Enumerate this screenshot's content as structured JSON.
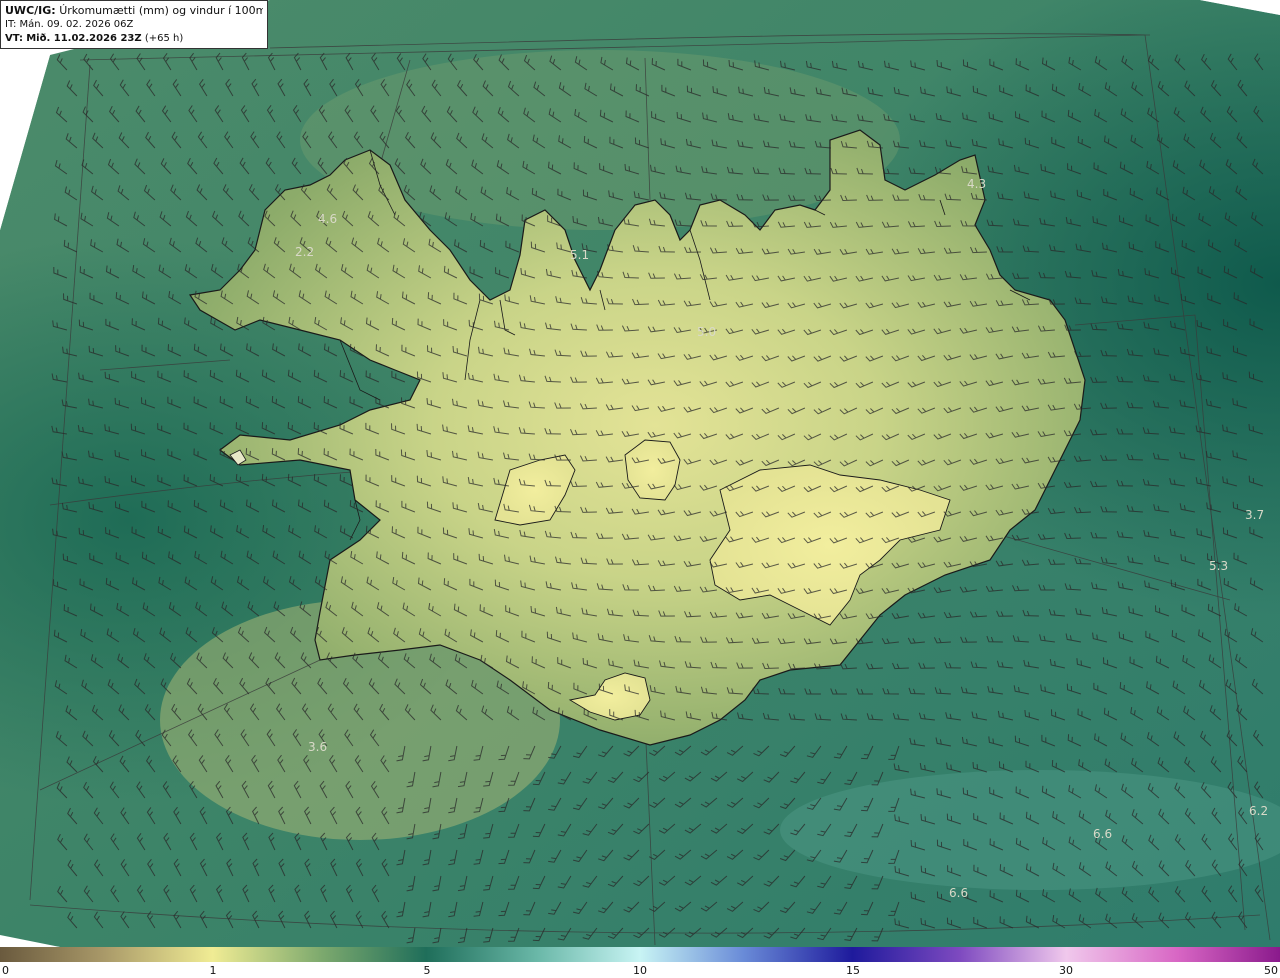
{
  "header": {
    "product_label": "UWC/IG:",
    "product_title": "Úrkomumætti (mm) og vindur í 100m hæð",
    "it_text": "IT: Mán. 09. 02. 2026 06Z",
    "vt_label": "VT:",
    "vt_value": "Mið. 11.02.2026 23Z",
    "vt_offset": "(+65 h)"
  },
  "colorbar": {
    "ticks": [
      "0",
      "1",
      "5",
      "10",
      "15",
      "30",
      "50"
    ]
  },
  "value_labels": [
    "4.3",
    "4.6",
    "2.2",
    "5.1",
    "5.0",
    "3.7",
    "5.3",
    "3.6",
    "6.2",
    "6.6",
    "6.6"
  ],
  "colors": {
    "ocean_dark": "#1d6a5a",
    "ocean_mid": "#3f8a6e",
    "land_light": "#d2d890",
    "land_mid": "#98b46e",
    "coast_line": "#1a1a1a",
    "barb_color": "#2a2a2a"
  }
}
